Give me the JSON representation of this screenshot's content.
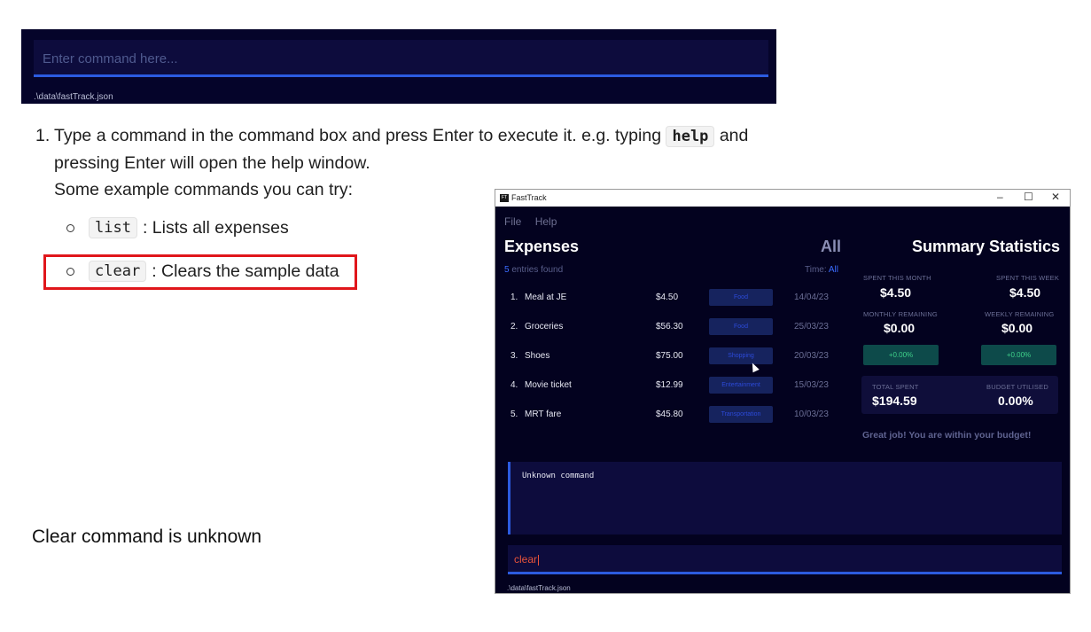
{
  "top_command_box": {
    "placeholder": "Enter command here...",
    "file_path": ".\\data\\fastTrack.json"
  },
  "instructions": {
    "number": "1.",
    "line1_before": "Type a command in the command box and press Enter to execute it. e.g. typing ",
    "help_code": "help",
    "line1_after": " and",
    "line2": "pressing Enter will open the help window.",
    "line3": "Some example commands you can try:",
    "examples": [
      {
        "code": "list",
        "text": ": Lists all expenses"
      },
      {
        "code": "clear",
        "text": ": Clears the sample data"
      }
    ]
  },
  "caption": "Clear command is unknown",
  "app": {
    "window_title": "FastTrack",
    "app_icon_text": "FT",
    "controls": {
      "minimize": "–",
      "maximize": "☐",
      "close": "✕"
    },
    "menu": [
      "File",
      "Help"
    ],
    "expenses_title": "Expenses",
    "filter_label": "All",
    "entries_count": "5",
    "entries_text": " entries found",
    "time_label": "Time: ",
    "time_value": "All",
    "expenses": [
      {
        "index": "1.",
        "name": "Meal at JE",
        "amount": "$4.50",
        "category": "Food",
        "date": "14/04/23"
      },
      {
        "index": "2.",
        "name": "Groceries",
        "amount": "$56.30",
        "category": "Food",
        "date": "25/03/23"
      },
      {
        "index": "3.",
        "name": "Shoes",
        "amount": "$75.00",
        "category": "Shopping",
        "date": "20/03/23"
      },
      {
        "index": "4.",
        "name": "Movie ticket",
        "amount": "$12.99",
        "category": "Entertainment",
        "date": "15/03/23"
      },
      {
        "index": "5.",
        "name": "MRT fare",
        "amount": "$45.80",
        "category": "Transportation",
        "date": "10/03/23"
      }
    ],
    "summary": {
      "title": "Summary Statistics",
      "spent_month_label": "SPENT THIS MONTH",
      "spent_month": "$4.50",
      "spent_week_label": "SPENT THIS WEEK",
      "spent_week": "$4.50",
      "monthly_remaining_label": "MONTHLY REMAINING",
      "monthly_remaining": "$0.00",
      "weekly_remaining_label": "WEEKLY REMAINING",
      "weekly_remaining": "$0.00",
      "monthly_change": "+0.00%",
      "weekly_change": "+0.00%",
      "total_spent_label": "TOTAL SPENT",
      "total_spent": "$194.59",
      "budget_utilised_label": "BUDGET UTILISED",
      "budget_utilised": "0.00%",
      "message": "Great job! You are within your budget!"
    },
    "result_text": "Unknown command",
    "command_value": "clear",
    "file_path": ".\\data\\fastTrack.json"
  },
  "colors": {
    "app_bg": "#03021f",
    "accent_blue": "#2c5be0",
    "highlight_red": "#e0161b",
    "error_text": "#e8533a",
    "positive_green": "#3fd08a"
  }
}
